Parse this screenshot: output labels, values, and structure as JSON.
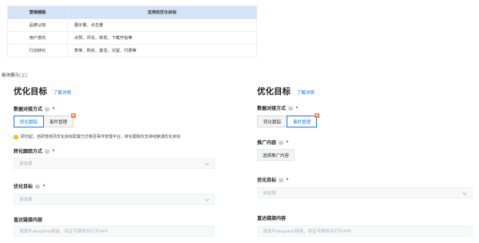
{
  "table": {
    "headers": [
      "营销链路",
      "支持的优化目标"
    ],
    "rows": [
      [
        "品牌认知",
        "展示量、点击量"
      ],
      [
        "用户意向",
        "点赞、评论、转发、下载开始等"
      ],
      [
        "行动转化",
        "表单、购买、激活、次留、付费等"
      ]
    ]
  },
  "module_note": "板块展示□□",
  "left_panel": {
    "title": "优化目标",
    "more_link": "了解详情",
    "docking_label": "数据对接方式",
    "tab_conversion": "转化跟踪",
    "tab_event": "事件管理",
    "notice": "即日起，自研落地页优化目标配置已迁移至事件管理平台，转化跟踪仅支持线索通优化目标",
    "conversion_label": "转化跟踪方式",
    "conversion_placeholder": "请选择",
    "goal_label": "优化目标",
    "goal_placeholder": "请选择",
    "deeplink_label": "直达链接内容",
    "deeplink_placeholder": "请填写deeplink链接，保证可跳转并打开APP"
  },
  "right_panel": {
    "title": "优化目标",
    "more_link": "了解详情",
    "docking_label": "数据对接方式",
    "tab_conversion": "转化跟踪",
    "tab_event": "事件管理",
    "promo_label": "推广内容",
    "promo_button": "选择推广内容",
    "goal_label": "优化目标",
    "goal_placeholder": "请选择",
    "deeplink_label": "直达链接内容",
    "deeplink_placeholder": "请填写deeplink链接，保证可跳转并打开APP"
  },
  "icons": {
    "help": "help-circle-icon",
    "warning": "warning-circle-icon",
    "badge": "new-badge-icon",
    "chevron": "chevron-down-icon"
  },
  "colors": {
    "accent": "#1677ff",
    "required": "#f5222d",
    "warning": "#faad14",
    "badge": "#ff7a2e",
    "table_header": "#d5e3f7"
  }
}
